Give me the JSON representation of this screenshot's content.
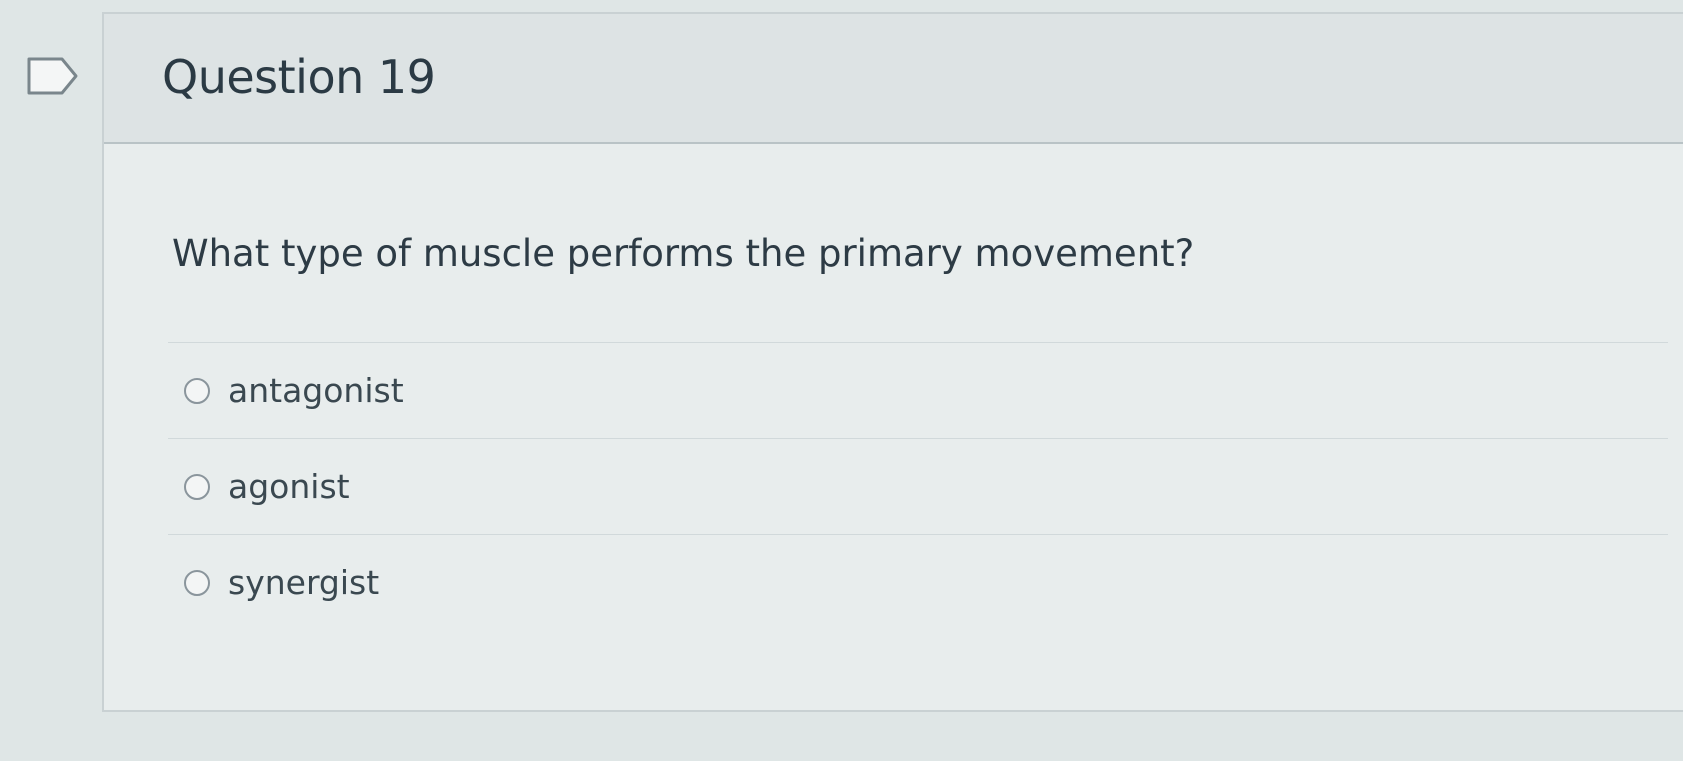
{
  "question": {
    "title": "Question 19",
    "text": "What type of muscle performs the primary movement?",
    "answers": [
      {
        "label": "antagonist"
      },
      {
        "label": "agonist"
      },
      {
        "label": "synergist"
      }
    ]
  },
  "icons": {
    "flag": "flag-question-icon",
    "radio": "radio-unchecked-icon"
  }
}
